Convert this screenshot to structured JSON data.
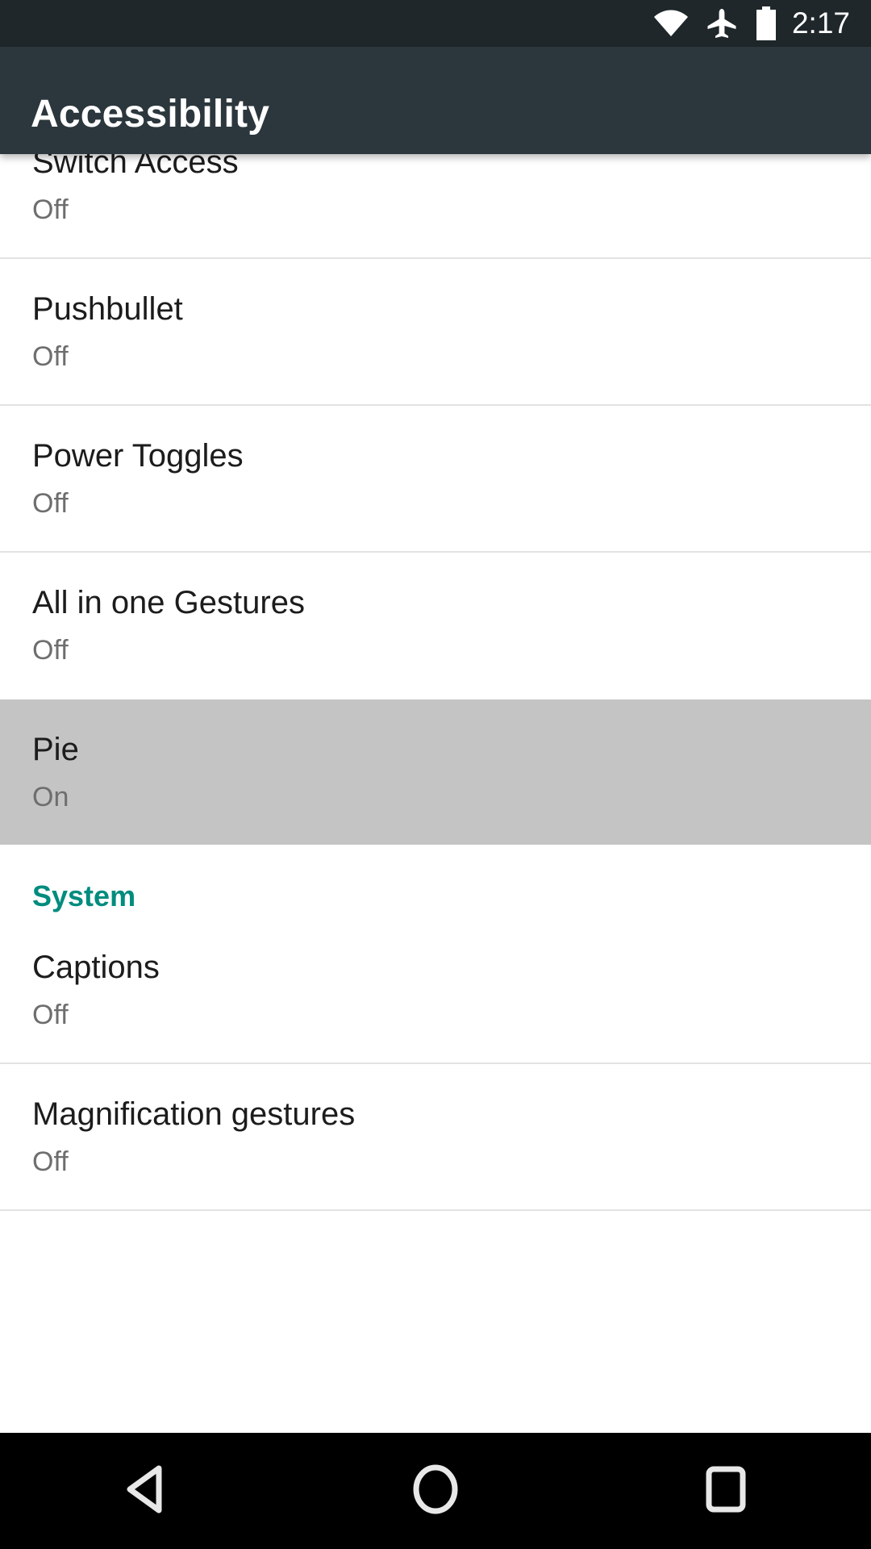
{
  "status_bar": {
    "time": "2:17",
    "icons": [
      "wifi-icon",
      "airplane-mode-icon",
      "battery-icon"
    ],
    "background_color": "#1f272b"
  },
  "app_bar": {
    "title": "Accessibility",
    "background_color": "#2b373d",
    "title_color": "#ffffff"
  },
  "list": {
    "items": [
      {
        "title": "Switch Access",
        "subtitle": "Off",
        "selected": false
      },
      {
        "title": "Pushbullet",
        "subtitle": "Off",
        "selected": false
      },
      {
        "title": "Power Toggles",
        "subtitle": "Off",
        "selected": false
      },
      {
        "title": "All in one Gestures",
        "subtitle": "Off",
        "selected": false
      },
      {
        "title": "Pie",
        "subtitle": "On",
        "selected": true
      }
    ],
    "section": {
      "label": "System",
      "color": "#008c7e",
      "items": [
        {
          "title": "Captions",
          "subtitle": "Off",
          "selected": false
        },
        {
          "title": "Magnification gestures",
          "subtitle": "Off",
          "selected": false
        }
      ]
    },
    "selected_row_background": "#c4c4c4",
    "divider_color": "#e2e2e2"
  },
  "nav_bar": {
    "background_color": "#000000",
    "buttons": [
      {
        "name": "back-button",
        "icon": "back-triangle-icon"
      },
      {
        "name": "home-button",
        "icon": "home-circle-icon"
      },
      {
        "name": "recents-button",
        "icon": "recents-square-icon"
      }
    ]
  }
}
